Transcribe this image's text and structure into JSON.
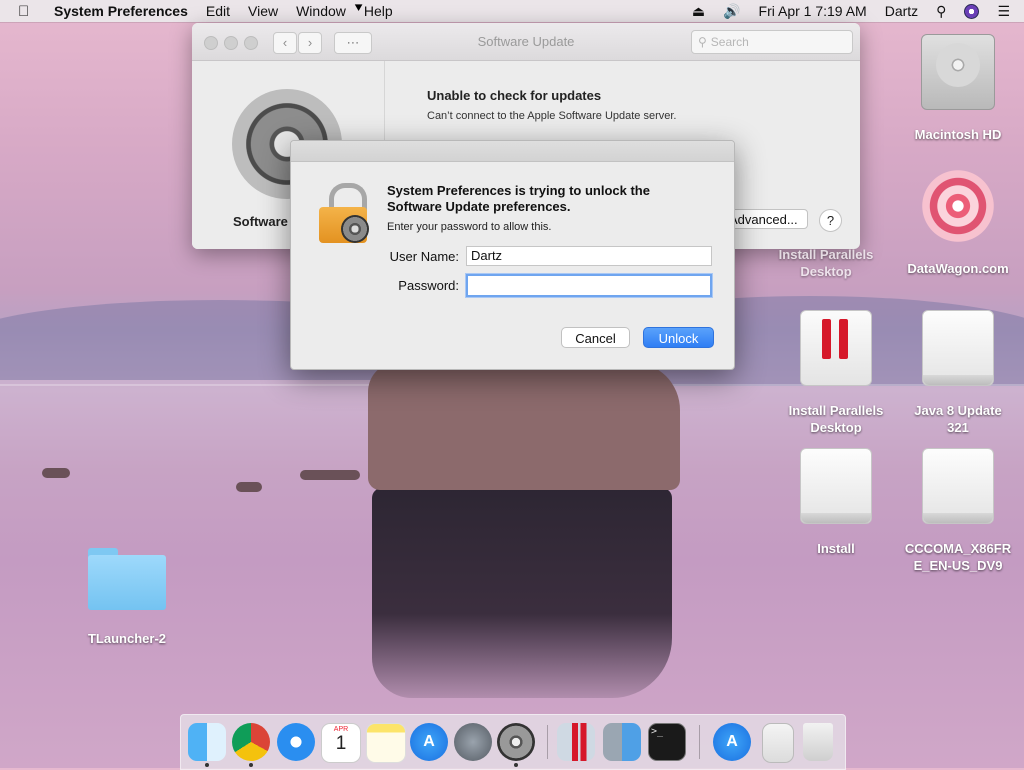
{
  "menubar": {
    "apple": "",
    "app_name": "System Preferences",
    "menus": [
      "Edit",
      "View",
      "Window",
      "Help"
    ],
    "datetime": "Fri Apr 1  7:19 AM",
    "user": "Dartz"
  },
  "sysprefs": {
    "title": "Software Update",
    "search_placeholder": "Search",
    "left_label": "Software",
    "heading": "Unable to check for updates",
    "subtext": "Can’t connect to the Apple Software Update server.",
    "advanced_label": "Advanced...",
    "help_label": "?"
  },
  "dialog": {
    "title": "System Preferences is trying to unlock the Software Update preferences.",
    "description": "Enter your password to allow this.",
    "username_label": "User Name:",
    "username_value": "Dartz",
    "password_label": "Password:",
    "password_value": "",
    "cancel_label": "Cancel",
    "unlock_label": "Unlock"
  },
  "desktop": {
    "icons": [
      {
        "name": "Macintosh HD"
      },
      {
        "name": "Install Parallels Desktop"
      },
      {
        "name": "DataWagon.com"
      },
      {
        "name": "Install Parallels Desktop"
      },
      {
        "name": "Java 8 Update 321"
      },
      {
        "name": "Install"
      },
      {
        "name": "CCCOMA_X86FRE_EN-US_DV9"
      },
      {
        "name": "TLauncher-2"
      }
    ]
  },
  "dock": {
    "items": [
      "Finder",
      "Google Chrome",
      "Safari",
      "Calendar",
      "Notes",
      "App Store",
      "Launchpad",
      "System Preferences",
      "Parallels Desktop",
      "Migration Assistant",
      "Terminal",
      "App Store",
      "Preview",
      "Trash"
    ],
    "calendar_month": "APR",
    "calendar_day": "1"
  }
}
